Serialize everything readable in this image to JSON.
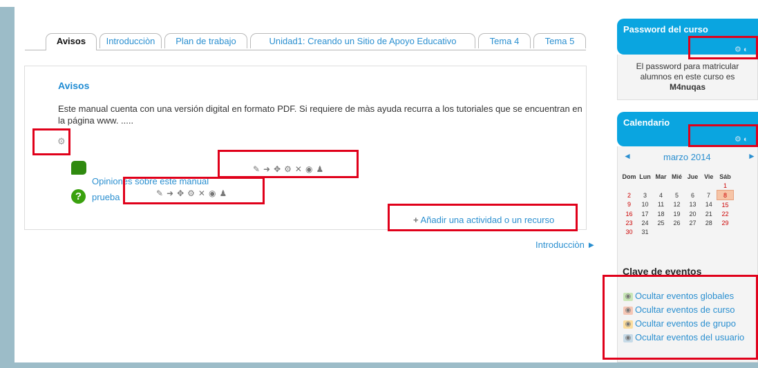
{
  "tabs": [
    {
      "label": "Avisos",
      "active": true
    },
    {
      "label": "Introducciòn"
    },
    {
      "label": "Plan de trabajo"
    },
    {
      "label": "Unidad1: Creando un Sitio de Apoyo Educativo"
    },
    {
      "label": "Tema 4"
    },
    {
      "label": "Tema 5"
    }
  ],
  "section": {
    "title": "Avisos",
    "summary": "Este manual cuenta con una versión digital en formato PDF. Si requiere de màs ayuda recurra a los tutoriales que se encuentran en la página www. .....",
    "activities": [
      {
        "label": "Opiniones sobre este manual",
        "icon": "forum-icon"
      },
      {
        "label": "prueba",
        "icon": "quiz-icon"
      }
    ],
    "edit_icons": [
      "pencil-icon",
      "move-right-icon",
      "move-icon",
      "gear-icon",
      "delete-icon",
      "eye-icon",
      "user-icon"
    ],
    "add_label": "Añadir una actividad o un recurso",
    "next_link": "Introducciòn ►"
  },
  "password_block": {
    "title": "Password del curso",
    "line1": "El password para matricular",
    "line2": "alumnos en este curso es",
    "password": "M4nuqas"
  },
  "calendar_block": {
    "title": "Calendario",
    "prev": "◄",
    "next": "►",
    "month": "marzo 2014",
    "weekdays": [
      "Dom",
      "Lun",
      "Mar",
      "Mié",
      "Jue",
      "Vie",
      "Sáb"
    ],
    "weeks": [
      [
        "",
        "",
        "",
        "",
        "",
        "",
        "1"
      ],
      [
        "2",
        "3",
        "4",
        "5",
        "6",
        "7",
        "8"
      ],
      [
        "9",
        "10",
        "11",
        "12",
        "13",
        "14",
        "15"
      ],
      [
        "16",
        "17",
        "18",
        "19",
        "20",
        "21",
        "22"
      ],
      [
        "23",
        "24",
        "25",
        "26",
        "27",
        "28",
        "29"
      ],
      [
        "30",
        "31",
        "",
        "",
        "",
        "",
        ""
      ]
    ],
    "today": "8",
    "key_title": "Clave de eventos",
    "keys": [
      {
        "label": "Ocultar eventos globales",
        "color": "#c9e7b7"
      },
      {
        "label": "Ocultar eventos de curso",
        "color": "#f5c6b5"
      },
      {
        "label": "Ocultar eventos de grupo",
        "color": "#fbdd9e"
      },
      {
        "label": "Ocultar eventos del usuario",
        "color": "#c7dbe8"
      }
    ]
  },
  "colors": {
    "accent": "#0aa5e0",
    "link": "#2a8fd0",
    "highlight": "#e0001a"
  }
}
